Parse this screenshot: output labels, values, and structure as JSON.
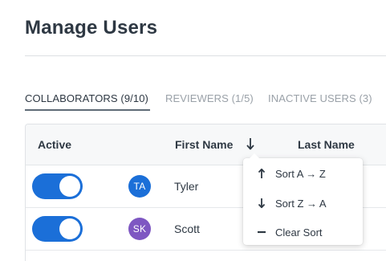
{
  "page": {
    "title": "Manage Users"
  },
  "tabs": [
    {
      "label": "COLLABORATORS (9/10)",
      "active": true
    },
    {
      "label": "REVIEWERS (1/5)",
      "active": false
    },
    {
      "label": "INACTIVE USERS (3)",
      "active": false
    }
  ],
  "table": {
    "columns": {
      "active": "Active",
      "first_name": "First Name",
      "last_name": "Last Name"
    },
    "sort_icon": "arrow-down-icon",
    "rows": [
      {
        "active": true,
        "initials": "TA",
        "avatar_color": "#1b6fd8",
        "first_name": "Tyler"
      },
      {
        "active": true,
        "initials": "SK",
        "avatar_color": "#7e57c2",
        "first_name": "Scott"
      }
    ]
  },
  "sort_menu": {
    "items": [
      {
        "label": "Sort A → Z",
        "icon": "arrow-up-icon"
      },
      {
        "label": "Sort Z → A",
        "icon": "arrow-down-icon"
      },
      {
        "label": "Clear Sort",
        "icon": "minus-icon"
      }
    ]
  },
  "colors": {
    "toggle_on": "#1b6fd8",
    "primary_text": "#2e3843",
    "muted_text": "#9aa1a8"
  }
}
